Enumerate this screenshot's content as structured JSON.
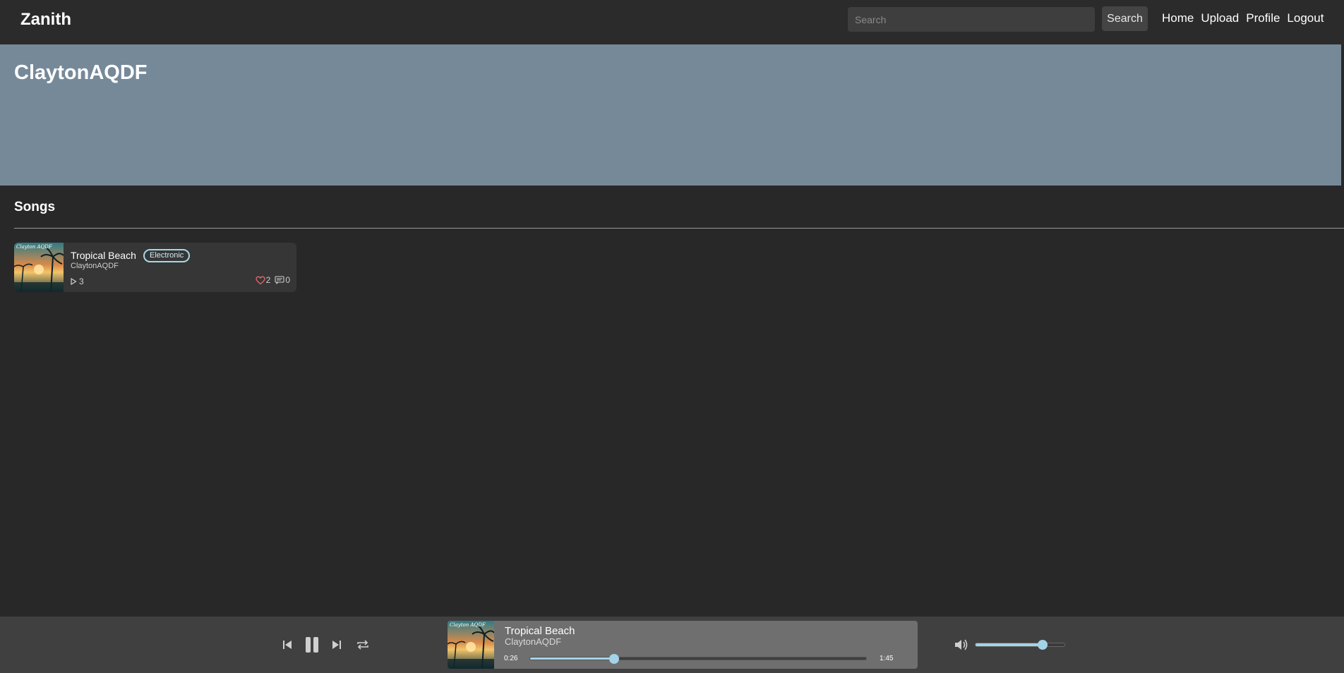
{
  "navbar": {
    "brand": "Zanith",
    "search_placeholder": "Search",
    "search_button": "Search",
    "links": [
      "Home",
      "Upload",
      "Profile",
      "Logout"
    ]
  },
  "profile": {
    "username": "ClaytonAQDF",
    "banner_color": "#768999"
  },
  "songs": {
    "heading": "Songs",
    "items": [
      {
        "title": "Tropical Beach",
        "genre": "Electronic",
        "artist": "ClaytonAQDF",
        "plays": "3",
        "likes": "2",
        "comments": "0",
        "cover_text": "Clayton AQDF"
      }
    ]
  },
  "player": {
    "title": "Tropical Beach",
    "artist": "ClaytonAQDF",
    "elapsed": "0:26",
    "duration": "1:45",
    "progress": 0.25,
    "volume": 0.75,
    "accent_color": "#a3d3e8",
    "icons": [
      "skip-back-icon",
      "pause-icon",
      "skip-forward-icon",
      "repeat-icon",
      "volume-icon"
    ]
  }
}
